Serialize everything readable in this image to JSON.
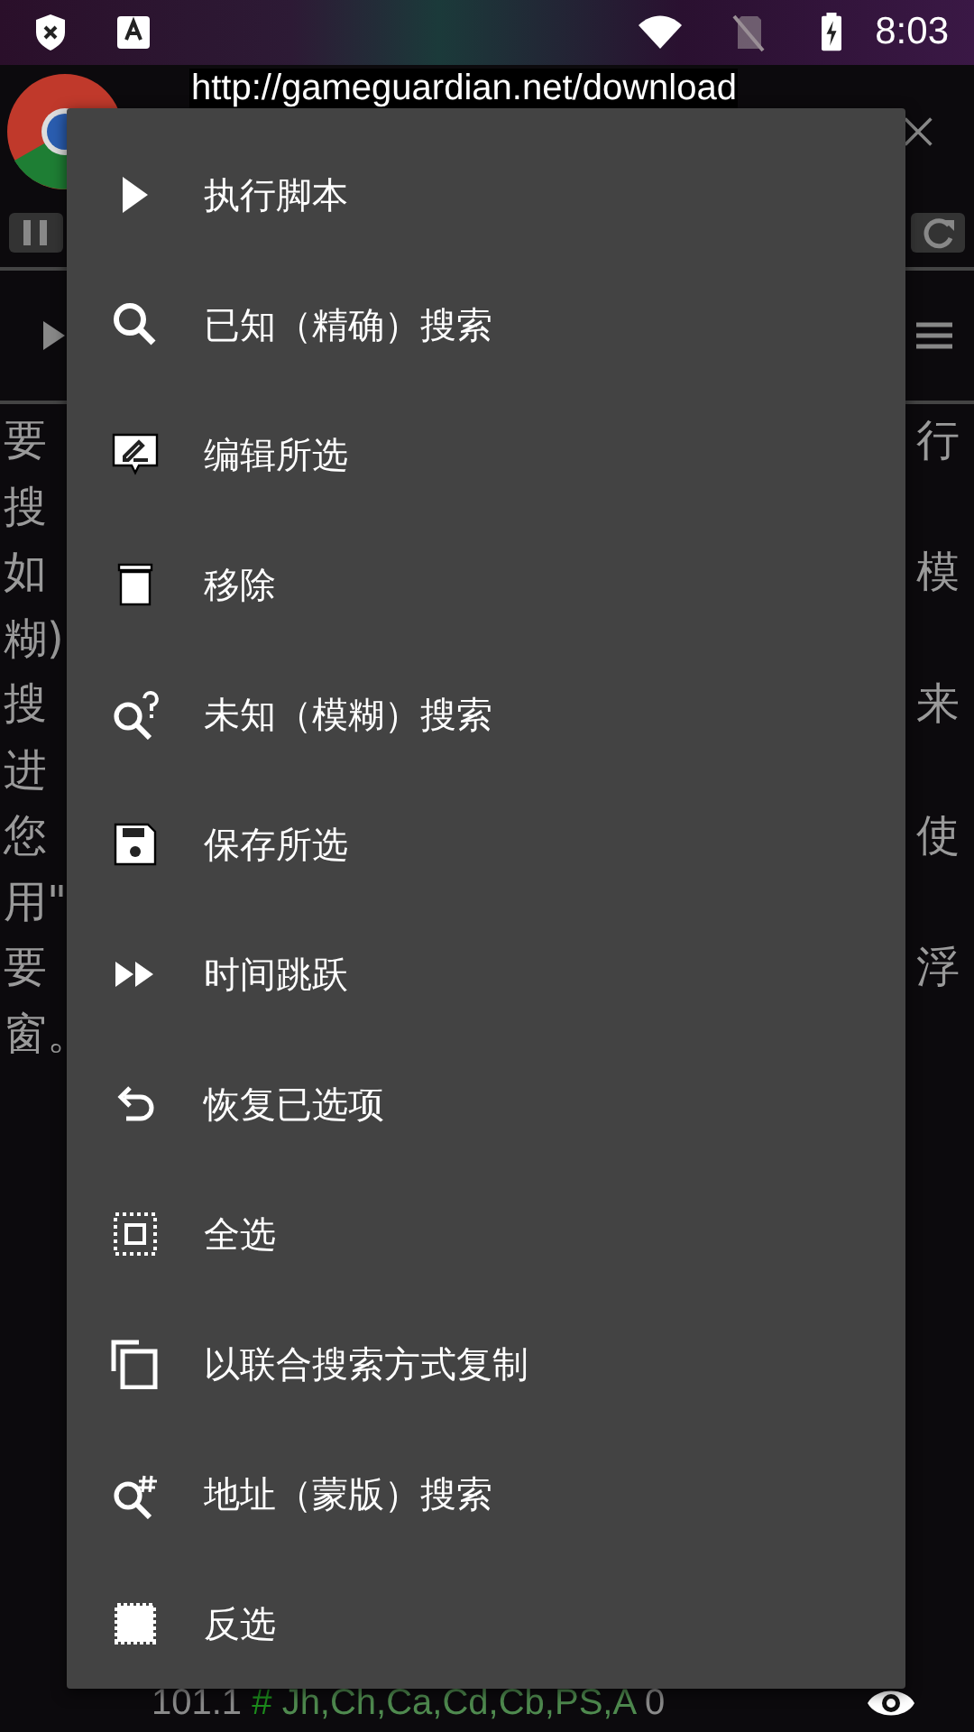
{
  "status_bar": {
    "time": "8:03"
  },
  "url_label": "http://gameguardian.net/download",
  "background_text": [
    {
      "left": "要",
      "right": "行"
    },
    {
      "left": "搜"
    },
    {
      "left": "如",
      "right": "模"
    },
    {
      "left": "糊)"
    },
    {
      "left": "搜",
      "right": "来"
    },
    {
      "left": "进"
    },
    {
      "left": "您",
      "right": "使"
    },
    {
      "left": "用\""
    },
    {
      "left": "要",
      "right": "浮"
    },
    {
      "left": "窗。"
    }
  ],
  "footer": {
    "value": "101.1",
    "hash": "#",
    "regions": "Jh,Ch,Ca,Cd,Cb,PS,A",
    "count": "0"
  },
  "menu": {
    "items": [
      {
        "kind": "play",
        "label": "执行脚本"
      },
      {
        "kind": "search",
        "label": "已知（精确）搜索"
      },
      {
        "kind": "edit",
        "label": "编辑所选"
      },
      {
        "kind": "trash",
        "label": "移除"
      },
      {
        "kind": "fuzzy",
        "label": "未知（模糊）搜索"
      },
      {
        "kind": "save",
        "label": "保存所选"
      },
      {
        "kind": "forward",
        "label": "时间跳跃"
      },
      {
        "kind": "undo",
        "label": "恢复已选项"
      },
      {
        "kind": "selectall",
        "label": "全选"
      },
      {
        "kind": "copy",
        "label": "以联合搜索方式复制"
      },
      {
        "kind": "address",
        "label": "地址（蒙版）搜索"
      },
      {
        "kind": "invert",
        "label": "反选"
      }
    ]
  }
}
